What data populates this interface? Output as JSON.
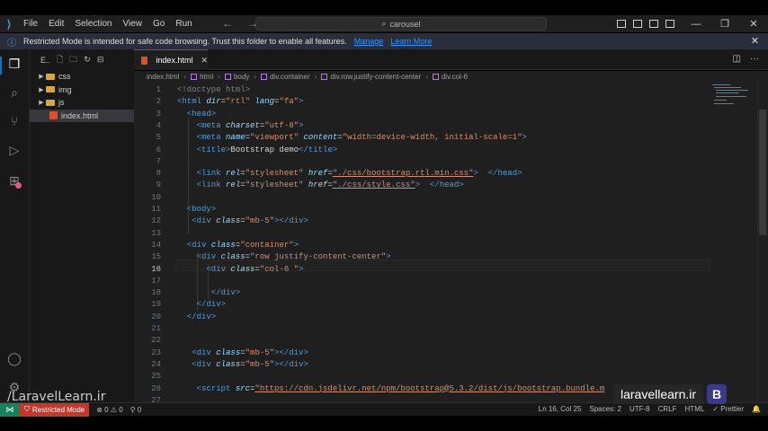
{
  "titlebar": {
    "menu": [
      "File",
      "Edit",
      "Selection",
      "View",
      "Go",
      "Run"
    ],
    "search": "carousel"
  },
  "banner": {
    "message": "Restricted Mode is intended for safe code browsing. Trust this folder to enable all features.",
    "manage": "Manage",
    "learn_more": "Learn More"
  },
  "sidebar": {
    "toolbar_label": "E..",
    "items": [
      {
        "label": "css",
        "type": "folder"
      },
      {
        "label": "img",
        "type": "folder"
      },
      {
        "label": "js",
        "type": "folder"
      },
      {
        "label": "index.html",
        "type": "file"
      }
    ]
  },
  "tab": {
    "label": "index.html"
  },
  "breadcrumb": [
    "index.html",
    "html",
    "body",
    "div.container",
    "div.row.justify-content-center",
    "div.col-6"
  ],
  "editor": {
    "line_numbers": [
      "1",
      "2",
      "3",
      "4",
      "5",
      "6",
      "7",
      "8",
      "9",
      "10",
      "11",
      "12",
      "13",
      "14",
      "15",
      "16",
      "17",
      "18",
      "19",
      "20",
      "21",
      "22",
      "23",
      "24",
      "25",
      "26",
      "27"
    ],
    "current_line": "16",
    "lines": [
      [
        [
          "kw",
          "<!doctype html>"
        ]
      ],
      [
        [
          "tag",
          "<html "
        ],
        [
          "attr",
          "dir"
        ],
        [
          "txt",
          "="
        ],
        [
          "str",
          "\"rtl\" "
        ],
        [
          "attr",
          "lang"
        ],
        [
          "txt",
          "="
        ],
        [
          "str",
          "\"fa\""
        ],
        [
          "tag",
          ">"
        ]
      ],
      [
        [
          "tag",
          "  <head>"
        ]
      ],
      [
        [
          "tag",
          "    <meta "
        ],
        [
          "attr",
          "charset"
        ],
        [
          "txt",
          "="
        ],
        [
          "str",
          "\"utf-8\""
        ],
        [
          "tag",
          ">"
        ]
      ],
      [
        [
          "tag",
          "    <meta "
        ],
        [
          "attr",
          "name"
        ],
        [
          "txt",
          "="
        ],
        [
          "str",
          "\"viewport\" "
        ],
        [
          "attr",
          "content"
        ],
        [
          "txt",
          "="
        ],
        [
          "str",
          "\"width=device-width, initial-scale=1\""
        ],
        [
          "tag",
          ">"
        ]
      ],
      [
        [
          "tag",
          "    <title>"
        ],
        [
          "txt",
          "Bootstrap demo"
        ],
        [
          "tag",
          "</title>"
        ]
      ],
      [],
      [
        [
          "tag",
          "    <link "
        ],
        [
          "attr",
          "rel"
        ],
        [
          "txt",
          "="
        ],
        [
          "str",
          "\"stylesheet\" "
        ],
        [
          "attr",
          "href"
        ],
        [
          "txt",
          "="
        ],
        [
          "url",
          "\"./css/bootstrap.rtl.min.css\""
        ],
        [
          "tag",
          ">  </head>"
        ]
      ],
      [
        [
          "tag",
          "    <link "
        ],
        [
          "attr",
          "rel"
        ],
        [
          "txt",
          "="
        ],
        [
          "str",
          "\"stylesheet\" "
        ],
        [
          "attr",
          "href"
        ],
        [
          "txt",
          "="
        ],
        [
          "url",
          "\"./css/style.css\""
        ],
        [
          "tag",
          ">  </head>"
        ]
      ],
      [],
      [
        [
          "tag",
          "  <body>"
        ]
      ],
      [
        [
          "tag",
          "   <div "
        ],
        [
          "attr",
          "class"
        ],
        [
          "txt",
          "="
        ],
        [
          "str",
          "\"mb-5\""
        ],
        [
          "tag",
          "></div>"
        ]
      ],
      [],
      [
        [
          "tag",
          "  <div "
        ],
        [
          "attr",
          "class"
        ],
        [
          "txt",
          "="
        ],
        [
          "str",
          "\"container\""
        ],
        [
          "tag",
          ">"
        ]
      ],
      [
        [
          "tag",
          "    <div "
        ],
        [
          "attr",
          "class"
        ],
        [
          "txt",
          "="
        ],
        [
          "str",
          "\"row justify-content-center\""
        ],
        [
          "tag",
          ">"
        ]
      ],
      [
        [
          "tag",
          "      <div "
        ],
        [
          "attr",
          "class"
        ],
        [
          "txt",
          "="
        ],
        [
          "str",
          "\"col-6 \""
        ],
        [
          "tag",
          ">"
        ]
      ],
      [],
      [
        [
          "tag",
          "       </div>"
        ]
      ],
      [
        [
          "tag",
          "    </div>"
        ]
      ],
      [
        [
          "tag",
          "  </div>"
        ]
      ],
      [],
      [],
      [
        [
          "tag",
          "   <div "
        ],
        [
          "attr",
          "class"
        ],
        [
          "txt",
          "="
        ],
        [
          "str",
          "\"mb-5\""
        ],
        [
          "tag",
          "></div>"
        ]
      ],
      [
        [
          "tag",
          "   <div "
        ],
        [
          "attr",
          "class"
        ],
        [
          "txt",
          "="
        ],
        [
          "str",
          "\"mb-5\""
        ],
        [
          "tag",
          "></div>"
        ]
      ],
      [],
      [
        [
          "tag",
          "    <script "
        ],
        [
          "attr",
          "src"
        ],
        [
          "txt",
          "="
        ],
        [
          "url",
          "\"https://cdn.jsdelivr.net/npm/bootstrap@5.3.2/dist/js/bootstrap.bundle.m"
        ]
      ],
      []
    ]
  },
  "statusbar": {
    "restricted": "Restricted Mode",
    "problems": "⊗ 0 ⚠ 0",
    "ports": "⚲ 0",
    "position": "Ln 16, Col 25",
    "spaces": "Spaces: 2",
    "encoding": "UTF-8",
    "eol": "CRLF",
    "language": "HTML",
    "prettier": "✓ Prettier"
  },
  "watermarks": {
    "left": "/LaravelLearn.ir",
    "right": "laravellearn.ir",
    "logo": "B"
  },
  "colors": {
    "accent": "#0078d4",
    "restricted_bg": "#c0392b",
    "remote_bg": "#16825d"
  }
}
